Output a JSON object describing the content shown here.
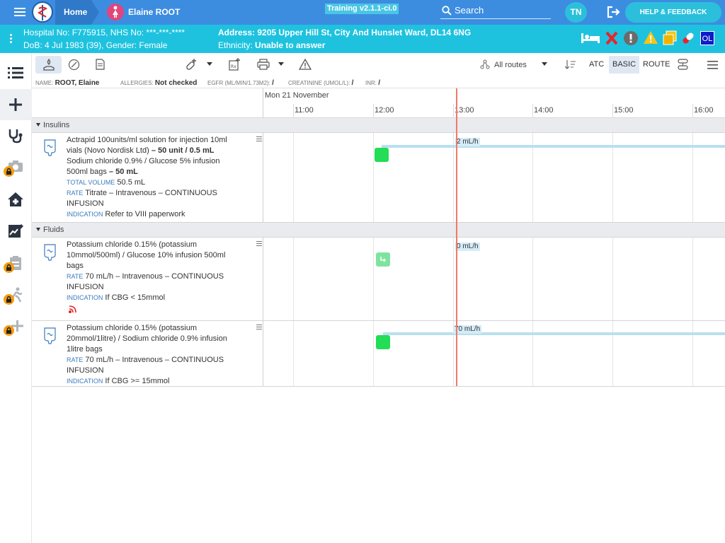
{
  "topbar": {
    "home_label": "Home",
    "patient_name": "Elaine ROOT",
    "training_label": "Training v2.1.1-ci.0",
    "search_label": "Search",
    "user_initials": "TN",
    "help_label": "HELP & FEEDBACK"
  },
  "banner": {
    "hospital_line": "Hospital No: F775915, NHS No: ***-***-****",
    "dob_line": "DoB: 4 Jul 1983 (39), Gender: Female",
    "address_line": "Address: 9205 Upper Hill St, City And Hunslet Ward, DL14 6NG",
    "ethnicity_prefix": "Ethnicity: ",
    "ethnicity_value": "Unable to answer",
    "ol_badge": "OL",
    "colors": {
      "banner": "#1ec2df",
      "topbar": "#3c8de0",
      "alert_red": "#e8242b",
      "warning": "#f5c518"
    }
  },
  "toolbar": {
    "routes_label": "All routes",
    "atc_label": "ATC",
    "basic_label": "BASIC",
    "route_label": "ROUTE"
  },
  "info": {
    "name_label": "NAME:",
    "name_value": "ROOT, Elaine",
    "allergies_label": "ALLERGIES:",
    "allergies_value": "Not checked",
    "egfr_label": "EGFR (ML/MIN/1.73M2):",
    "egfr_value": "/",
    "creatinine_label": "CREATININE (UMOL/L):",
    "creatinine_value": "/",
    "inr_label": "INR:",
    "inr_value": "/"
  },
  "timeline": {
    "date_label": "Mon 21 November",
    "hours": [
      "11:00",
      "12:00",
      "13:00",
      "14:00",
      "15:00",
      "16:00"
    ]
  },
  "sections": {
    "insulins": "Insulins",
    "fluids": "Fluids"
  },
  "meds": [
    {
      "line1": "Actrapid 100units/ml solution for injection 10ml vials (Novo Nordisk Ltd)",
      "dose1": " – 50 unit / 0.5 mL",
      "line2": "Sodium chloride 0.9% / Glucose 5% infusion 500ml bags",
      "dose2": " – 50 mL",
      "total_label": "TOTAL VOLUME",
      "total_value": " 50.5 mL",
      "rate_label": "RATE",
      "rate_value": " Titrate – Intravenous – CONTINUOUS INFUSION",
      "indication_label": "INDICATION",
      "indication_value": " Refer to VIII paperwork",
      "rate_display": "2 mL/h"
    },
    {
      "line1": "Potassium chloride 0.15% (potassium 10mmol/500ml) / Glucose 10% infusion 500ml bags",
      "rate_label": "RATE",
      "rate_value": " 70 mL/h – Intravenous – CONTINUOUS INFUSION",
      "indication_label": "INDICATION",
      "indication_value": " If CBG < 15mmol",
      "rate_display": "0 mL/h"
    },
    {
      "line1": "Potassium chloride 0.15% (potassium 20mmol/1litre) / Sodium chloride 0.9% infusion 1litre bags",
      "rate_label": "RATE",
      "rate_value": " 70 mL/h – Intravenous – CONTINUOUS INFUSION",
      "indication_label": "INDICATION",
      "indication_value": " If CBG >= 15mmol",
      "rate_display": "70 mL/h"
    }
  ]
}
